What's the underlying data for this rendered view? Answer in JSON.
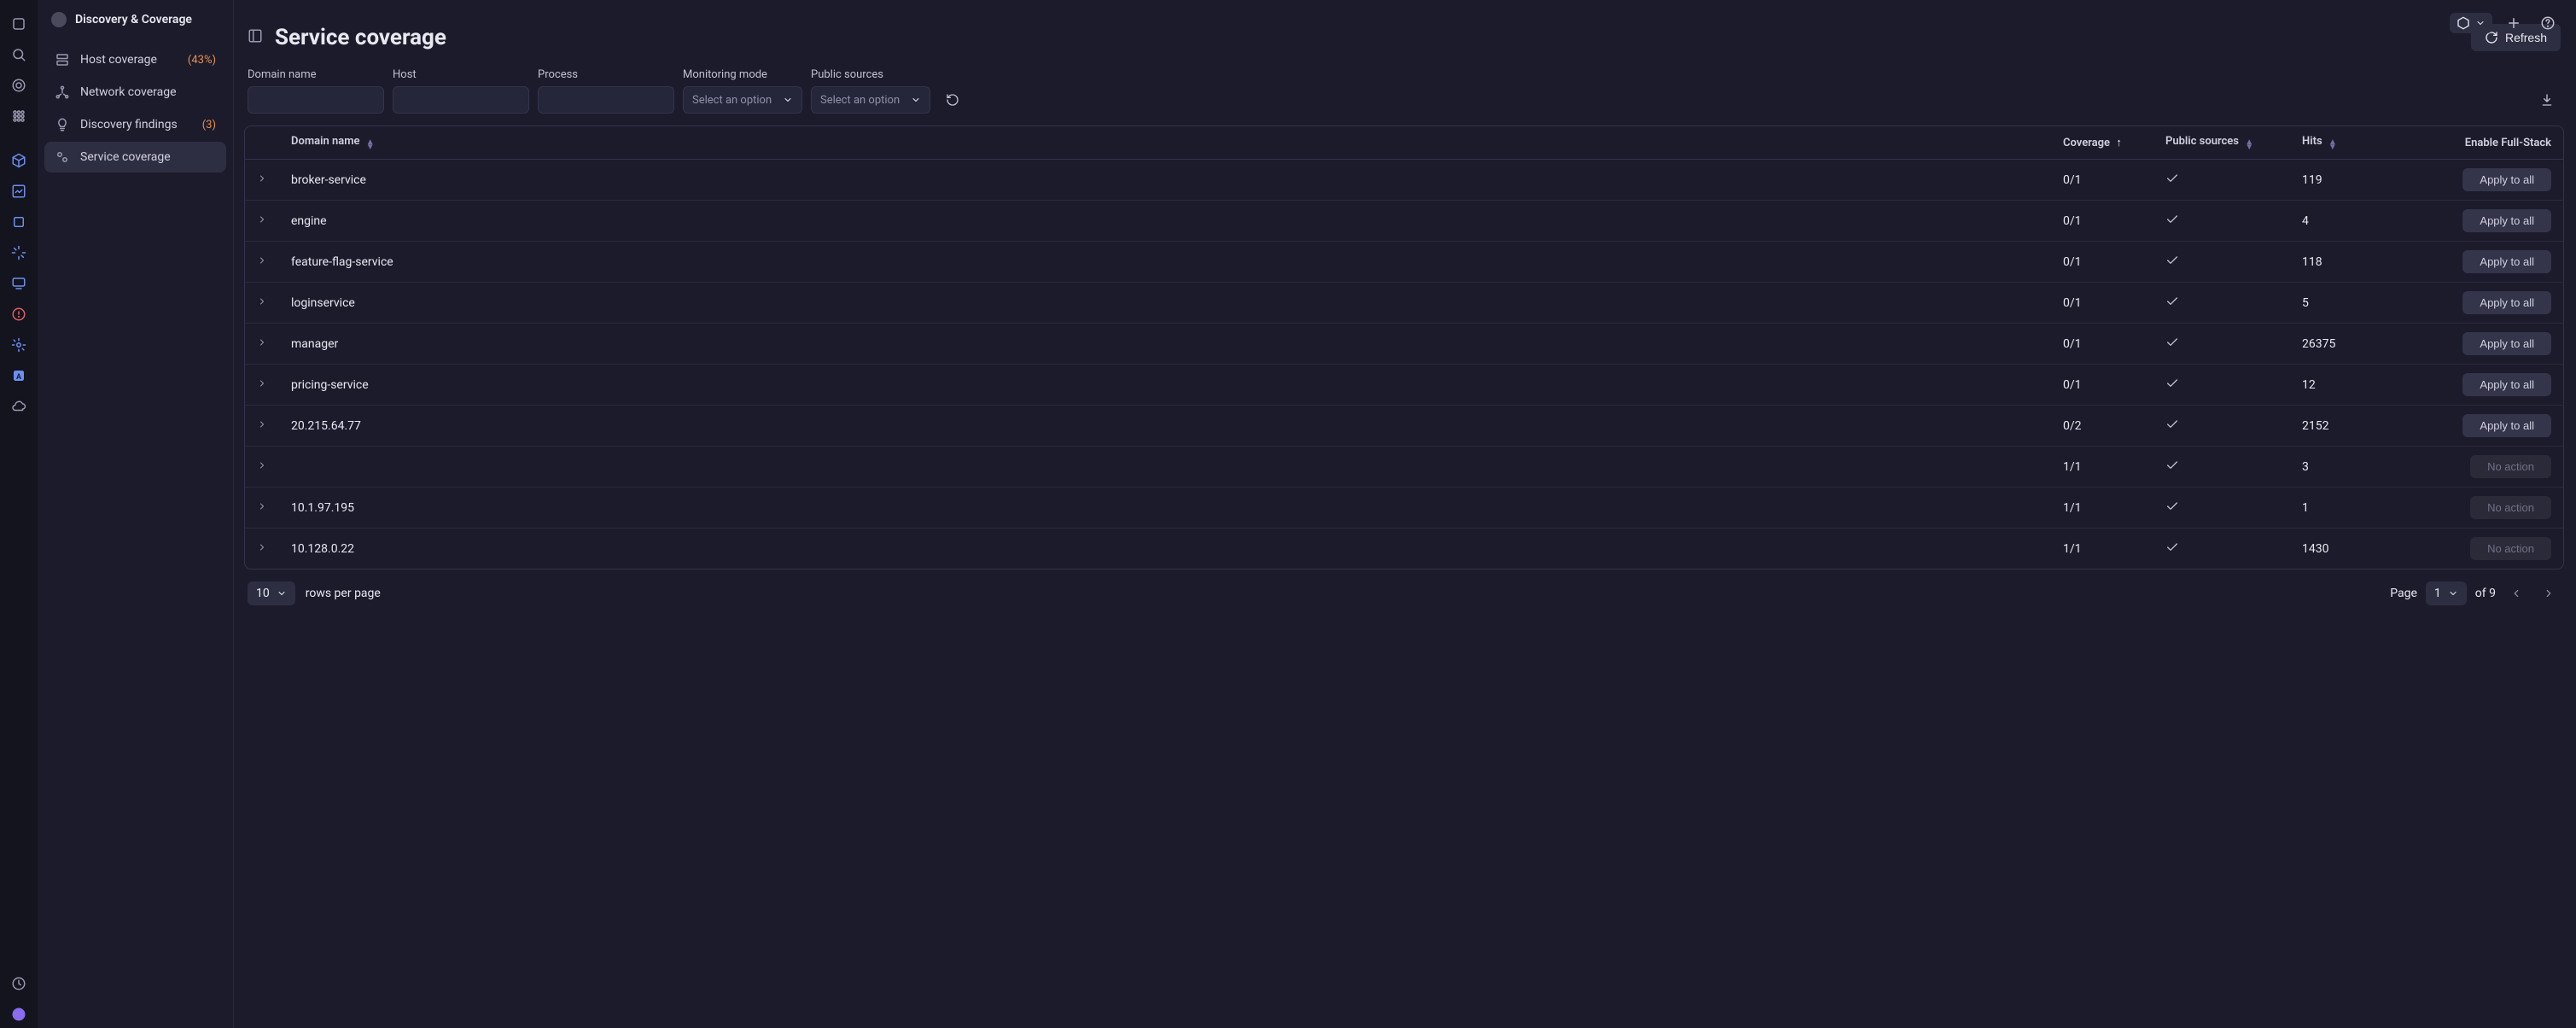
{
  "header": {
    "title": "Discovery & Coverage"
  },
  "sidebar": {
    "items": [
      {
        "label": "Host coverage",
        "count": "(43%)"
      },
      {
        "label": "Network coverage",
        "count": ""
      },
      {
        "label": "Discovery findings",
        "count": "(3)"
      },
      {
        "label": "Service coverage",
        "count": ""
      }
    ]
  },
  "page": {
    "title": "Service coverage",
    "refresh_label": "Refresh"
  },
  "filters": {
    "domain_label": "Domain name",
    "host_label": "Host",
    "process_label": "Process",
    "monitoring_label": "Monitoring mode",
    "monitoring_placeholder": "Select an option",
    "public_label": "Public sources",
    "public_placeholder": "Select an option"
  },
  "table": {
    "headers": {
      "domain": "Domain name",
      "coverage": "Coverage",
      "public": "Public sources",
      "hits": "Hits",
      "action": "Enable Full-Stack"
    },
    "rows": [
      {
        "domain": "broker-service",
        "coverage": "0/1",
        "public": true,
        "hits": "119",
        "action": "Apply to all",
        "enabled": true
      },
      {
        "domain": "engine",
        "coverage": "0/1",
        "public": true,
        "hits": "4",
        "action": "Apply to all",
        "enabled": true
      },
      {
        "domain": "feature-flag-service",
        "coverage": "0/1",
        "public": true,
        "hits": "118",
        "action": "Apply to all",
        "enabled": true
      },
      {
        "domain": "loginservice",
        "coverage": "0/1",
        "public": true,
        "hits": "5",
        "action": "Apply to all",
        "enabled": true
      },
      {
        "domain": "manager",
        "coverage": "0/1",
        "public": true,
        "hits": "26375",
        "action": "Apply to all",
        "enabled": true
      },
      {
        "domain": "pricing-service",
        "coverage": "0/1",
        "public": true,
        "hits": "12",
        "action": "Apply to all",
        "enabled": true
      },
      {
        "domain": "20.215.64.77",
        "coverage": "0/2",
        "public": true,
        "hits": "2152",
        "action": "Apply to all",
        "enabled": true
      },
      {
        "domain": "",
        "coverage": "1/1",
        "public": true,
        "hits": "3",
        "action": "No action",
        "enabled": false
      },
      {
        "domain": "10.1.97.195",
        "coverage": "1/1",
        "public": true,
        "hits": "1",
        "action": "No action",
        "enabled": false
      },
      {
        "domain": "10.128.0.22",
        "coverage": "1/1",
        "public": true,
        "hits": "1430",
        "action": "No action",
        "enabled": false
      }
    ]
  },
  "pagination": {
    "rows_value": "10",
    "rows_label": "rows per page",
    "page_label": "Page",
    "page_value": "1",
    "of_label": "of 9"
  }
}
